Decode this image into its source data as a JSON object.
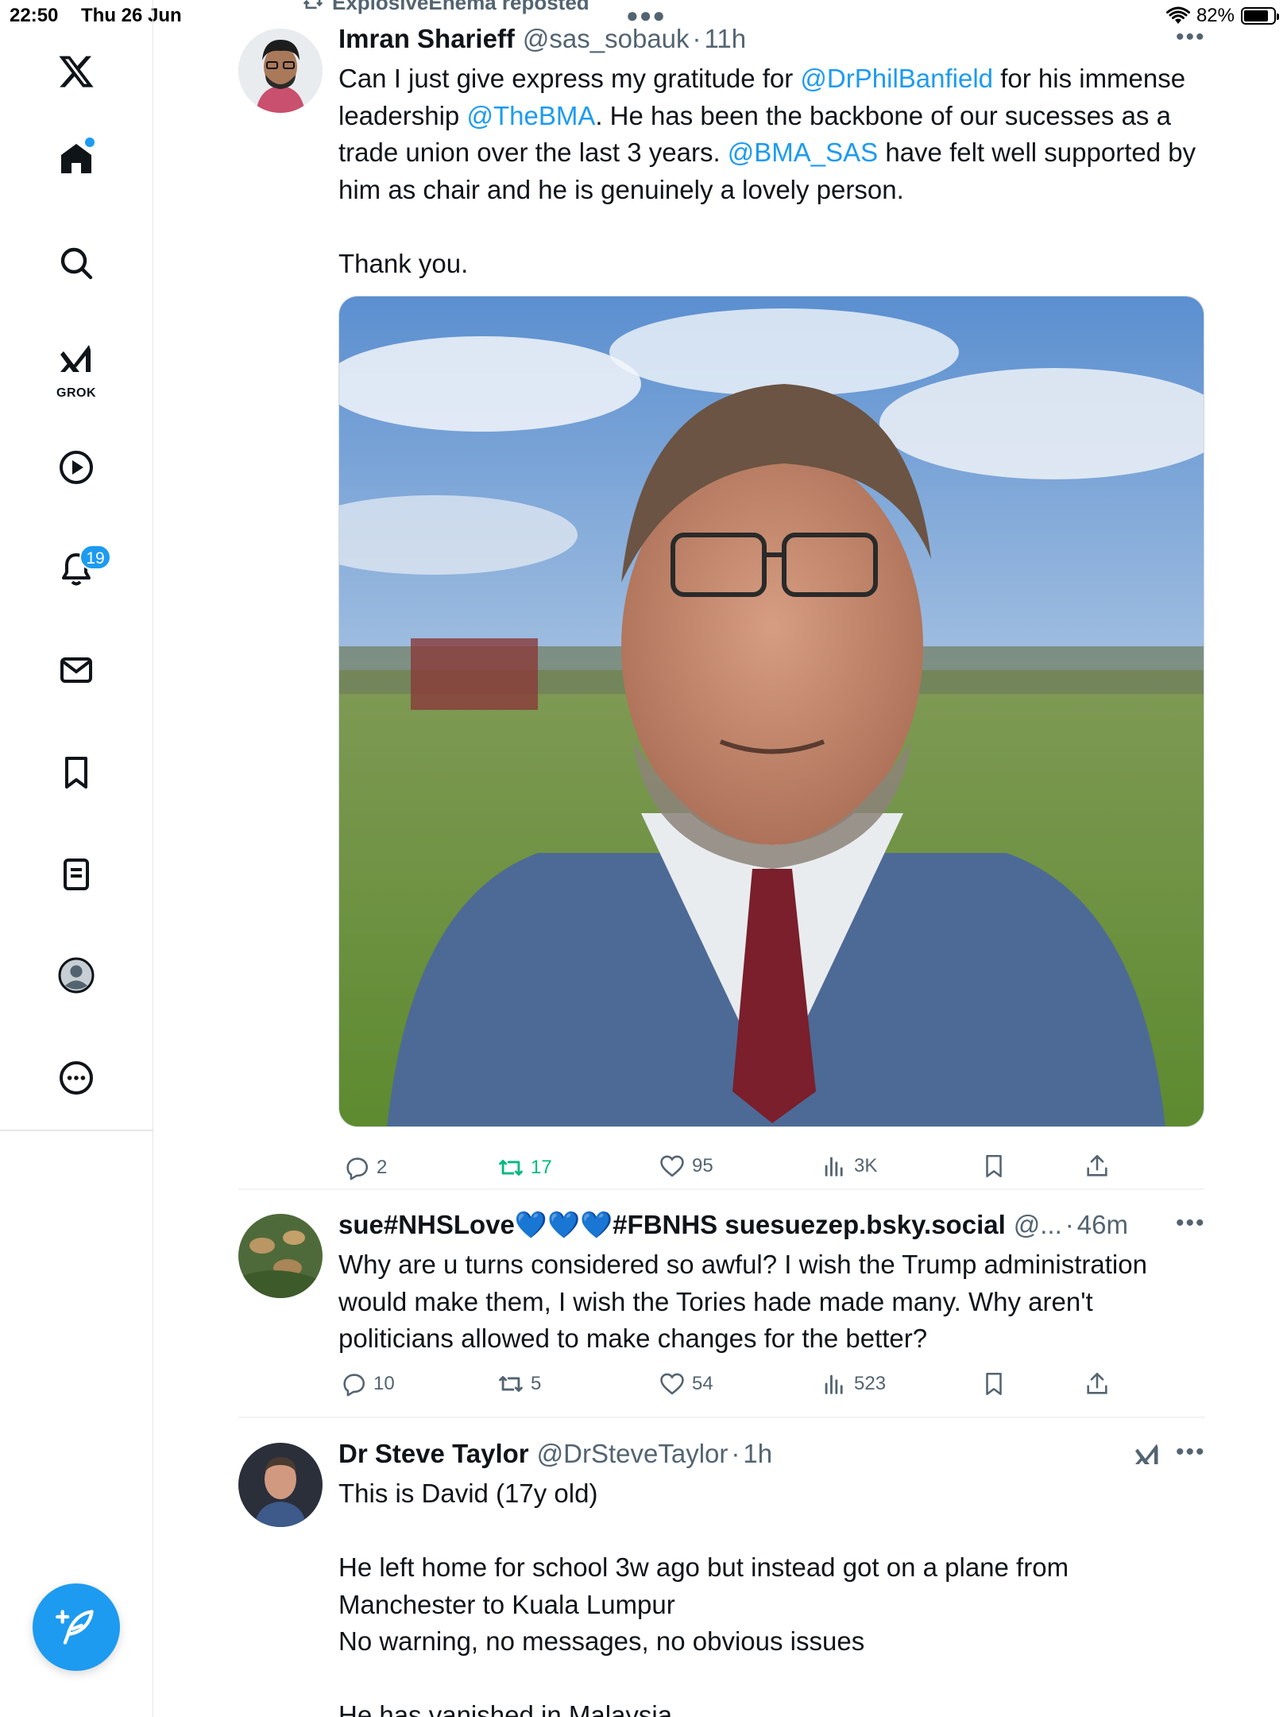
{
  "status_bar": {
    "time": "22:50",
    "date": "Thu 26 Jun",
    "battery": "82%",
    "battery_level": 0.82
  },
  "sidebar": {
    "items": [
      {
        "name": "home",
        "icon": "home-icon"
      },
      {
        "name": "explore",
        "icon": "search-icon"
      },
      {
        "name": "grok",
        "icon": "grok-icon",
        "label": "GROK"
      },
      {
        "name": "video",
        "icon": "play-icon"
      },
      {
        "name": "notifications",
        "icon": "bell-icon",
        "badge": "19"
      },
      {
        "name": "messages",
        "icon": "mail-icon"
      },
      {
        "name": "bookmarks",
        "icon": "bookmark-icon"
      },
      {
        "name": "lists",
        "icon": "list-icon"
      },
      {
        "name": "profile",
        "icon": "profile-icon"
      },
      {
        "name": "more",
        "icon": "more-circle-icon"
      }
    ],
    "compose_icon": "compose-icon",
    "accent": "#1d9bf0"
  },
  "feed": {
    "repost_banner": "ExplosiveEnema reposted",
    "tweets": [
      {
        "name": "Imran Sharieff",
        "handle": "@sas_sobauk",
        "sep": "·",
        "age": "11h",
        "text_parts": [
          "Can I just give express my gratitude for ",
          "@DrPhilBanfield",
          " for his immense leadership ",
          "@TheBMA",
          ". He has been the backbone of our sucesses as a trade union over the last 3 years. ",
          "@BMA_SAS",
          " have felt well supported by him as chair and he is genuinely a lovely person.\n\nThank you."
        ],
        "has_photo": true,
        "replies": "2",
        "reposts": "17",
        "likes": "95",
        "views": "3K"
      },
      {
        "name": "sue#NHSLove💙💙💙#FBNHS suesuezep.bsky.social",
        "handle": "@...",
        "sep": "·",
        "age": "46m",
        "text": "Why are u turns considered so awful? I wish the Trump administration would make them, I wish the Tories hade made many. Why aren't politicians allowed to make changes for the better?",
        "replies": "10",
        "reposts": "5",
        "likes": "54",
        "views": "523"
      },
      {
        "name": "Dr Steve Taylor",
        "handle": "@DrSteveTaylor",
        "sep": "·",
        "age": "1h",
        "text": "This is David (17y old)\n\nHe left home for school 3w ago but instead got on a plane from Manchester to Kuala Lumpur\nNo warning, no messages, no obvious issues\n\nHe has vanished in Malaysia"
      }
    ]
  }
}
